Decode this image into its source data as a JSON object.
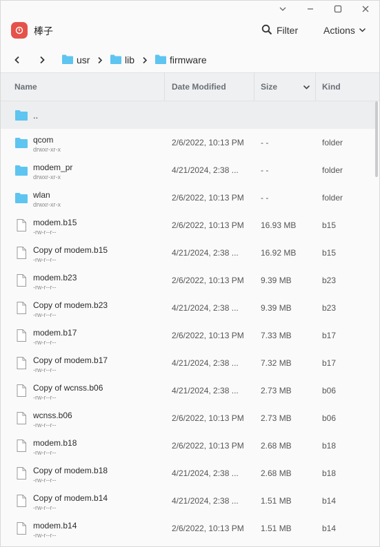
{
  "window": {
    "controls": [
      "chevron-down-icon",
      "minimize-icon",
      "maximize-icon",
      "close-icon"
    ]
  },
  "header": {
    "app_title": "棒子",
    "filter_label": "Filter",
    "actions_label": "Actions",
    "accent_color": "#e5524a"
  },
  "breadcrumb": {
    "items": [
      "usr",
      "lib",
      "firmware"
    ]
  },
  "columns": {
    "name": "Name",
    "date": "Date Modified",
    "size": "Size",
    "kind": "Kind"
  },
  "up_row": {
    "name": ".."
  },
  "files": [
    {
      "name": "qcom",
      "perm": "drwxr-xr-x",
      "date": "2/6/2022, 10:13 PM",
      "size": "- -",
      "kind": "folder",
      "type": "folder"
    },
    {
      "name": "modem_pr",
      "perm": "drwxr-xr-x",
      "date": "4/21/2024, 2:38 ...",
      "size": "- -",
      "kind": "folder",
      "type": "folder"
    },
    {
      "name": "wlan",
      "perm": "drwxr-xr-x",
      "date": "2/6/2022, 10:13 PM",
      "size": "- -",
      "kind": "folder",
      "type": "folder"
    },
    {
      "name": "modem.b15",
      "perm": "-rw-r--r--",
      "date": "2/6/2022, 10:13 PM",
      "size": "16.93 MB",
      "kind": "b15",
      "type": "file"
    },
    {
      "name": "Copy of modem.b15",
      "perm": "-rw-r--r--",
      "date": "4/21/2024, 2:38 ...",
      "size": "16.92 MB",
      "kind": "b15",
      "type": "file"
    },
    {
      "name": "modem.b23",
      "perm": "-rw-r--r--",
      "date": "2/6/2022, 10:13 PM",
      "size": "9.39 MB",
      "kind": "b23",
      "type": "file"
    },
    {
      "name": "Copy of modem.b23",
      "perm": "-rw-r--r--",
      "date": "4/21/2024, 2:38 ...",
      "size": "9.39 MB",
      "kind": "b23",
      "type": "file"
    },
    {
      "name": "modem.b17",
      "perm": "-rw-r--r--",
      "date": "2/6/2022, 10:13 PM",
      "size": "7.33 MB",
      "kind": "b17",
      "type": "file"
    },
    {
      "name": "Copy of modem.b17",
      "perm": "-rw-r--r--",
      "date": "4/21/2024, 2:38 ...",
      "size": "7.32 MB",
      "kind": "b17",
      "type": "file"
    },
    {
      "name": "Copy of wcnss.b06",
      "perm": "-rw-r--r--",
      "date": "4/21/2024, 2:38 ...",
      "size": "2.73 MB",
      "kind": "b06",
      "type": "file"
    },
    {
      "name": "wcnss.b06",
      "perm": "-rw-r--r--",
      "date": "2/6/2022, 10:13 PM",
      "size": "2.73 MB",
      "kind": "b06",
      "type": "file"
    },
    {
      "name": "modem.b18",
      "perm": "-rw-r--r--",
      "date": "2/6/2022, 10:13 PM",
      "size": "2.68 MB",
      "kind": "b18",
      "type": "file"
    },
    {
      "name": "Copy of modem.b18",
      "perm": "-rw-r--r--",
      "date": "4/21/2024, 2:38 ...",
      "size": "2.68 MB",
      "kind": "b18",
      "type": "file"
    },
    {
      "name": "Copy of modem.b14",
      "perm": "-rw-r--r--",
      "date": "4/21/2024, 2:38 ...",
      "size": "1.51 MB",
      "kind": "b14",
      "type": "file"
    },
    {
      "name": "modem.b14",
      "perm": "-rw-r--r--",
      "date": "2/6/2022, 10:13 PM",
      "size": "1.51 MB",
      "kind": "b14",
      "type": "file"
    }
  ],
  "colors": {
    "folder": "#5ec4f0",
    "header_bg": "#eef0f2",
    "selected_row": "#eceeef"
  }
}
